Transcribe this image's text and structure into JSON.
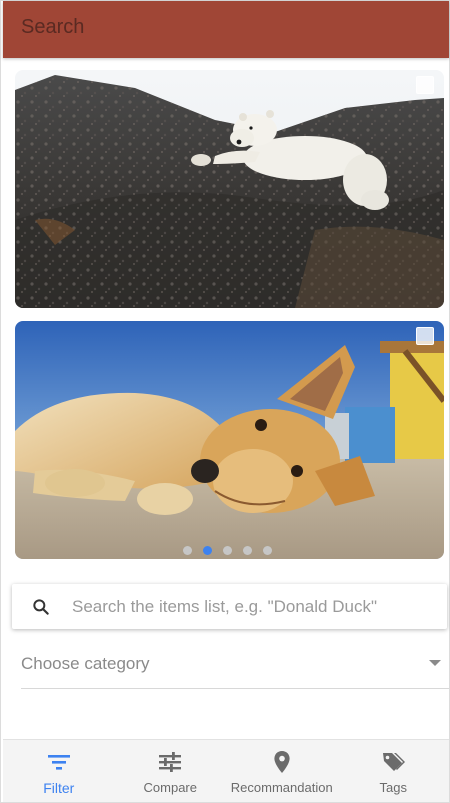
{
  "app_bar": {
    "title": "Search"
  },
  "carousel": {
    "cards": [
      {
        "image": "polar-bear-on-rocks"
      },
      {
        "image": "puppy-lying-on-sand"
      }
    ],
    "page_count": 5,
    "active_index": 1
  },
  "search": {
    "placeholder": "Search the items list, e.g. \"Donald Duck\"",
    "value": ""
  },
  "category": {
    "label": "Choose category"
  },
  "bottom_nav": {
    "items": [
      {
        "label": "Filter",
        "icon": "filter-icon",
        "active": true
      },
      {
        "label": "Compare",
        "icon": "sliders-icon",
        "active": false
      },
      {
        "label": "Recommandation",
        "icon": "location-pin-icon",
        "active": false
      },
      {
        "label": "Tags",
        "icon": "tags-icon",
        "active": false
      }
    ]
  },
  "colors": {
    "app_bar": "#a04636",
    "accent": "#3d82f0",
    "nav_background": "#f4f4f4"
  }
}
